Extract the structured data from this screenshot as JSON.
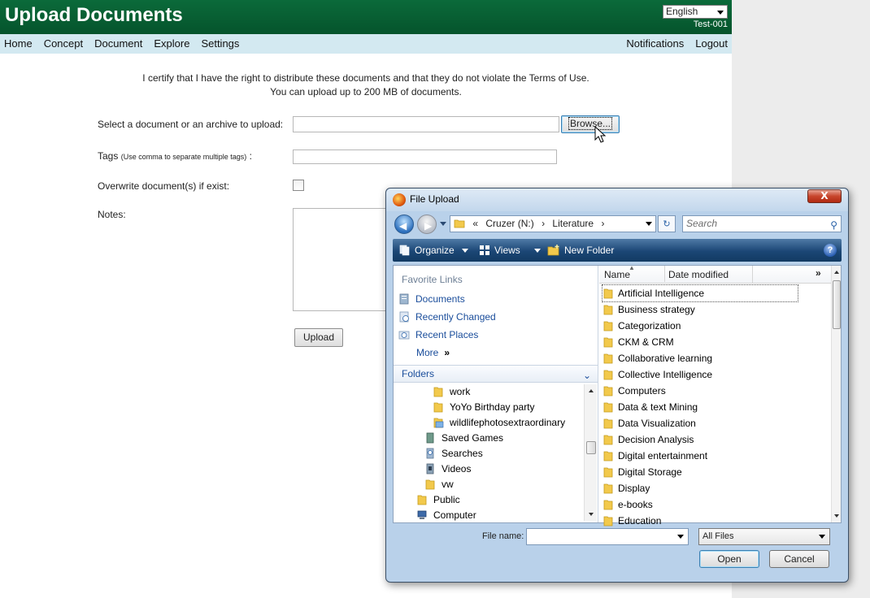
{
  "header": {
    "title": "Upload Documents",
    "language": "English",
    "user": "Test-001"
  },
  "nav": {
    "left": [
      "Home",
      "Concept",
      "Document",
      "Explore",
      "Settings"
    ],
    "right": [
      "Notifications",
      "Logout"
    ]
  },
  "form": {
    "cert_line1": "I certify that I have the right to distribute these documents and that they do not violate the Terms of Use.",
    "cert_line2": "You can upload up to 200 MB of documents.",
    "select_label": "Select a document or an archive to upload:",
    "browse_label": "Browse...",
    "tags_label": "Tags",
    "tags_hint": "(Use comma to separate multiple tags)",
    "tags_suffix": " :",
    "overwrite_label": "Overwrite document(s) if exist:",
    "notes_label": "Notes:",
    "upload_label": "Upload"
  },
  "dialog": {
    "title": "File Upload",
    "close_label": "X",
    "address": {
      "prefix": "«",
      "drive": "Cruzer (N:)",
      "folder": "Literature",
      "sep": "›"
    },
    "search_placeholder": "Search",
    "toolbar": {
      "organize": "Organize",
      "views": "Views",
      "new_folder": "New Folder",
      "help": "?"
    },
    "favorites_header": "Favorite Links",
    "favorites": [
      "Documents",
      "Recently Changed",
      "Recent Places",
      "More"
    ],
    "more_glyph": "»",
    "folders_header": "Folders",
    "tree": [
      "work",
      "YoYo Birthday party",
      "wildlifephotosextraordinary",
      "Saved Games",
      "Searches",
      "Videos",
      "vw",
      "Public",
      "Computer"
    ],
    "columns": {
      "name": "Name",
      "date": "Date modified",
      "more": "»"
    },
    "files": [
      "Artificial Intelligence",
      "Business strategy",
      "Categorization",
      "CKM & CRM",
      "Collaborative learning",
      "Collective Intelligence",
      "Computers",
      "Data & text Mining",
      "Data Visualization",
      "Decision Analysis",
      "Digital entertainment",
      "Digital Storage",
      "Display",
      "e-books",
      "Education"
    ],
    "filename_label": "File name:",
    "filename_value": "",
    "filetype": "All Files",
    "open_label": "Open",
    "cancel_label": "Cancel"
  },
  "colors": {
    "header_green": "#05542c",
    "nav_blue": "#d3e9f1",
    "link_blue": "#1a4d9b",
    "folder_yellow": "#f2c94c"
  }
}
